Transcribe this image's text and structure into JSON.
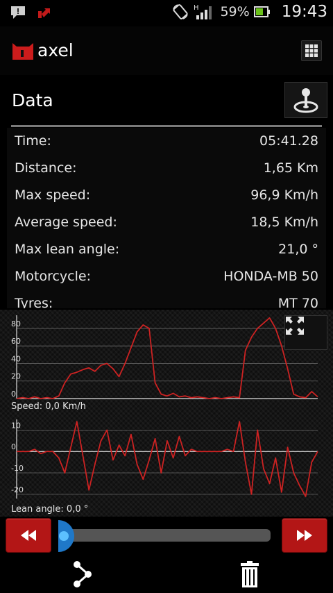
{
  "status_bar": {
    "battery_percent": "59%",
    "time": "19:43",
    "network_label": "H",
    "icons": [
      "chat-notification-icon",
      "upload-icon",
      "rotate-icon",
      "signal-icon",
      "battery-icon"
    ]
  },
  "app": {
    "title": "axel",
    "logo": "axel-logo",
    "menu_icon": "grid-icon",
    "accent_color": "#cc1c1c"
  },
  "data_section": {
    "title": "Data",
    "map_icon": "map-pin-icon",
    "stats": [
      {
        "label": "Time:",
        "value": "05:41.28"
      },
      {
        "label": "Distance:",
        "value": "1,65  Km"
      },
      {
        "label": "Max speed:",
        "value": "96,9  Km/h"
      },
      {
        "label": "Average speed:",
        "value": "18,5  Km/h"
      },
      {
        "label": "Max lean angle:",
        "value": "21,0 °"
      },
      {
        "label": "Motorcycle:",
        "value": "HONDA-MB 50"
      },
      {
        "label": "Tyres:",
        "value": "MT 70"
      }
    ]
  },
  "chart_data": [
    {
      "type": "line",
      "caption": "Speed: 0,0  Km/h",
      "ylim": [
        0,
        95
      ],
      "yticks": [
        0,
        20,
        40,
        60,
        80
      ],
      "series": [
        {
          "color": "#cc2222",
          "x": [
            0,
            2,
            4,
            6,
            8,
            10,
            12,
            14,
            16,
            18,
            20,
            22,
            24,
            26,
            28,
            30,
            32,
            34,
            36,
            38,
            40,
            42,
            44,
            46,
            48,
            50,
            52,
            54,
            56,
            58,
            60,
            62,
            64,
            66,
            68,
            70,
            72,
            74,
            76,
            78,
            80,
            82,
            84,
            86,
            88,
            90,
            92,
            94,
            96,
            98,
            100
          ],
          "values": [
            0,
            1,
            0,
            2,
            0,
            1,
            0,
            3,
            18,
            28,
            30,
            33,
            35,
            31,
            38,
            40,
            34,
            25,
            40,
            58,
            76,
            84,
            80,
            18,
            5,
            3,
            6,
            2,
            3,
            1,
            2,
            1,
            0,
            1,
            0,
            1,
            2,
            1,
            55,
            70,
            80,
            86,
            92,
            80,
            60,
            34,
            5,
            2,
            1,
            8,
            2
          ]
        }
      ]
    },
    {
      "type": "line",
      "caption": "Lean angle: 0,0 °",
      "ylim": [
        -22,
        15
      ],
      "yticks": [
        10,
        0,
        -10,
        -20
      ],
      "series": [
        {
          "color": "#cc2222",
          "x": [
            0,
            2,
            4,
            6,
            8,
            10,
            12,
            14,
            16,
            18,
            20,
            22,
            24,
            26,
            28,
            30,
            32,
            34,
            36,
            38,
            40,
            42,
            44,
            46,
            48,
            50,
            52,
            54,
            56,
            58,
            60,
            62,
            64,
            66,
            68,
            70,
            72,
            74,
            76,
            78,
            80,
            82,
            84,
            86,
            88,
            90,
            92,
            94,
            96,
            98,
            100
          ],
          "values": [
            0,
            0,
            0,
            1,
            -1,
            0,
            0,
            -3,
            -10,
            2,
            14,
            -2,
            -18,
            -6,
            5,
            10,
            -4,
            3,
            -2,
            8,
            -6,
            -13,
            -4,
            6,
            -10,
            5,
            -3,
            7,
            -2,
            1,
            0,
            0,
            0,
            0,
            0,
            1,
            0,
            14,
            -5,
            -20,
            10,
            -8,
            -15,
            -3,
            -19,
            2,
            -10,
            -16,
            -21,
            -5,
            0
          ]
        }
      ]
    }
  ],
  "playback": {
    "rewind_icon": "rewind-icon",
    "fast_forward_icon": "fast-forward-icon",
    "progress": 0.0
  },
  "bottom_bar": {
    "share_icon": "share-icon",
    "delete_icon": "trash-icon"
  }
}
